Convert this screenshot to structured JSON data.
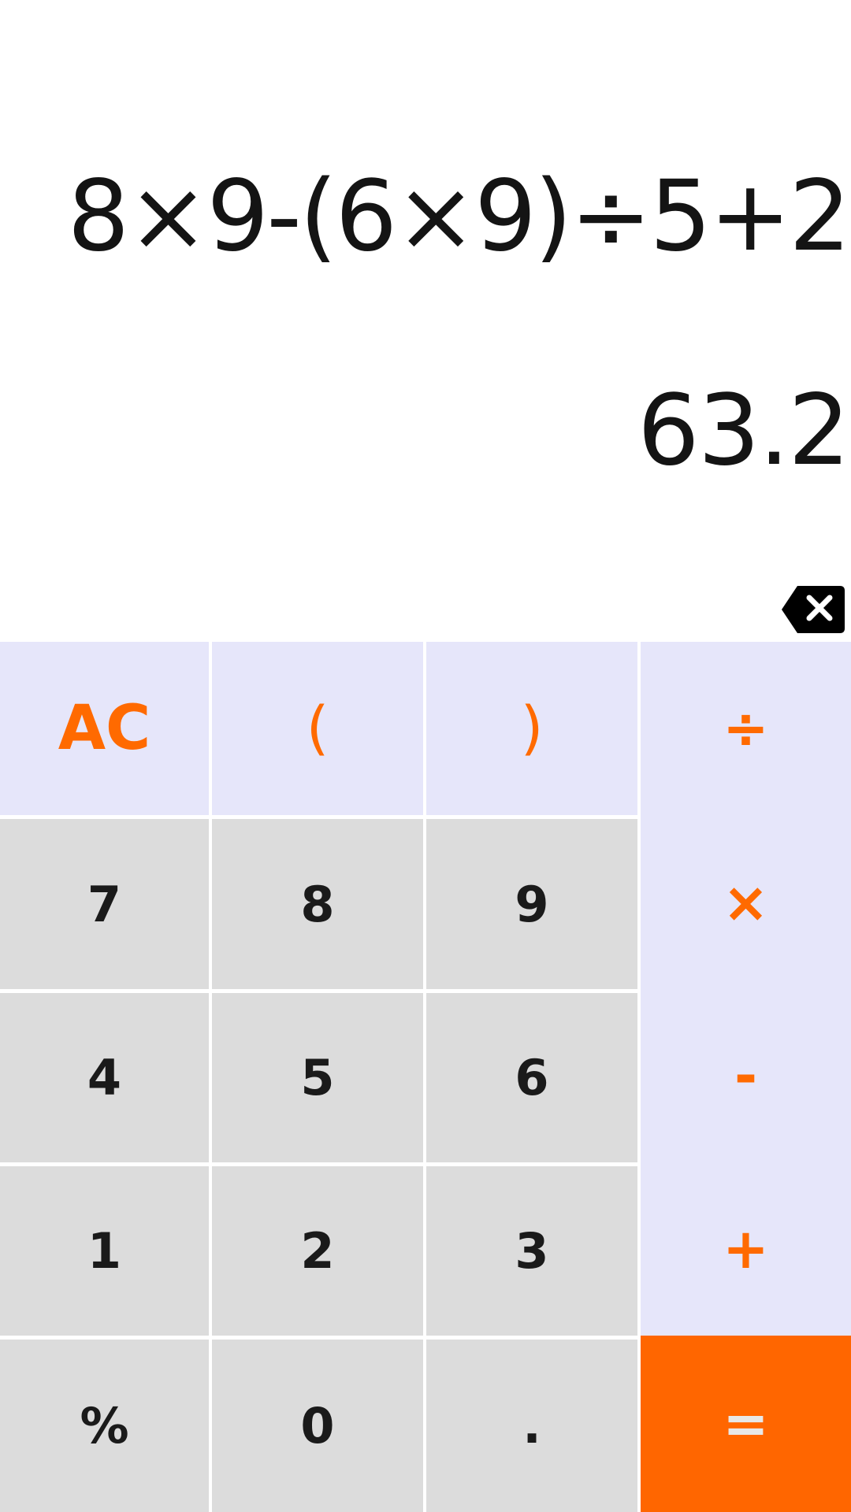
{
  "display": {
    "expression": "8×9-(6×9)÷5+2",
    "result": "63.2",
    "backspace_icon": "backspace-icon"
  },
  "keypad": {
    "rows": [
      [
        {
          "label": "AC",
          "kind": "op"
        },
        {
          "label": "(",
          "kind": "op"
        },
        {
          "label": ")",
          "kind": "op"
        },
        {
          "label": "÷",
          "kind": "op"
        }
      ],
      [
        {
          "label": "7",
          "kind": "num"
        },
        {
          "label": "8",
          "kind": "num"
        },
        {
          "label": "9",
          "kind": "num"
        },
        {
          "label": "×",
          "kind": "op"
        }
      ],
      [
        {
          "label": "4",
          "kind": "num"
        },
        {
          "label": "5",
          "kind": "num"
        },
        {
          "label": "6",
          "kind": "num"
        },
        {
          "label": "-",
          "kind": "op"
        }
      ],
      [
        {
          "label": "1",
          "kind": "num"
        },
        {
          "label": "2",
          "kind": "num"
        },
        {
          "label": "3",
          "kind": "num"
        },
        {
          "label": "+",
          "kind": "op"
        }
      ],
      [
        {
          "label": "%",
          "kind": "num"
        },
        {
          "label": "0",
          "kind": "num"
        },
        {
          "label": ".",
          "kind": "num"
        },
        {
          "label": "=",
          "kind": "eq"
        }
      ]
    ]
  },
  "colors": {
    "accent": "#ff6600",
    "operator_bg": "#e6e6fa",
    "digit_bg": "#dcdcdc",
    "text": "#141414"
  }
}
